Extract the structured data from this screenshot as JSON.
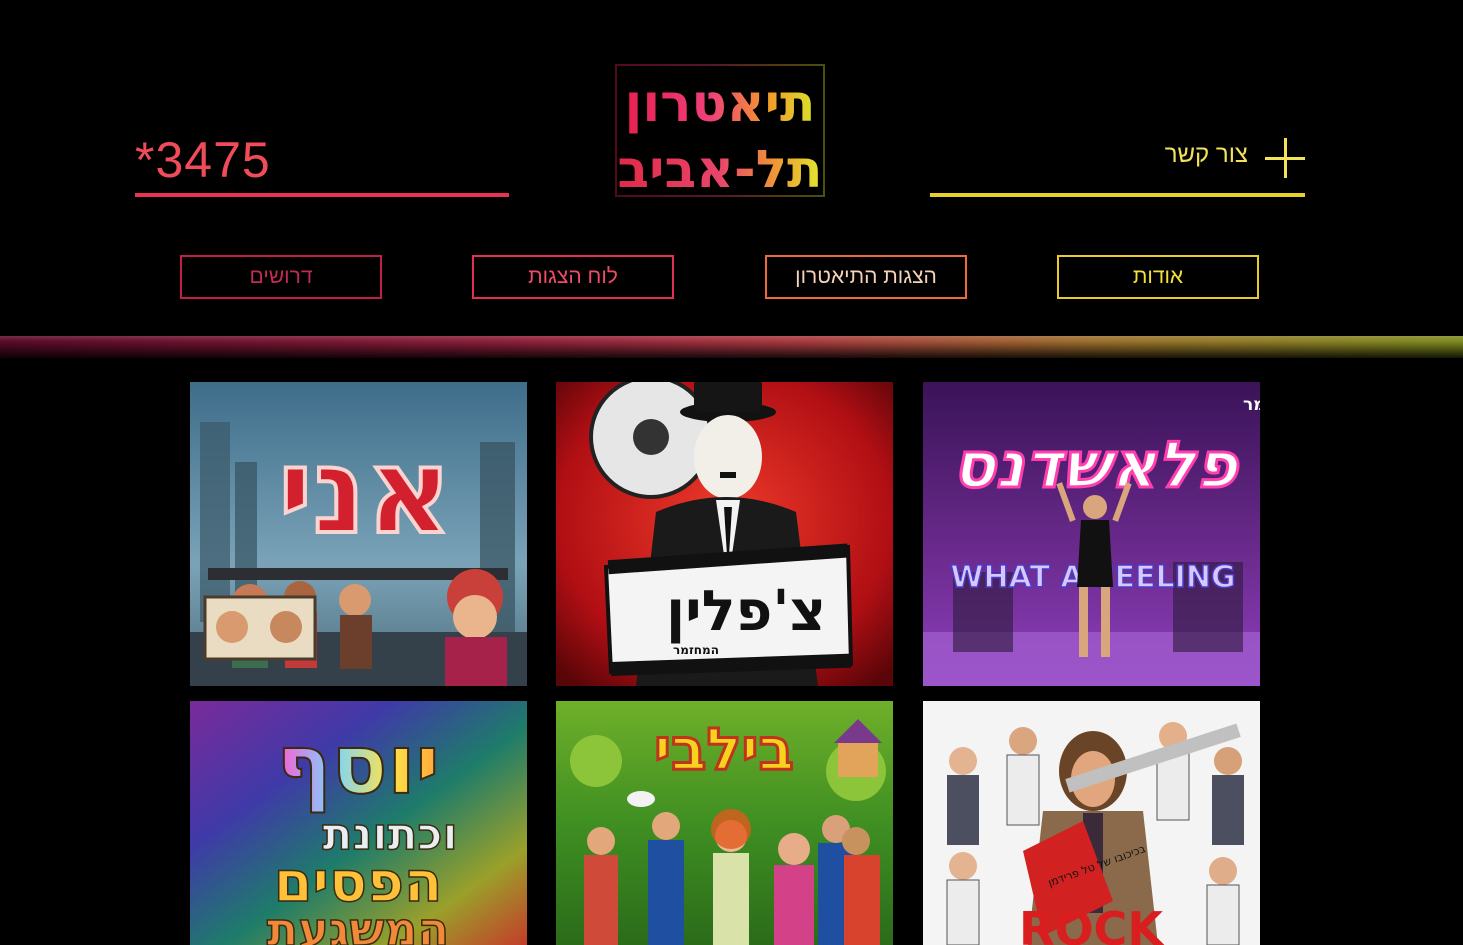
{
  "header": {
    "phone": "*3475",
    "contact_label": "צור קשר",
    "logo_line1": "תיאטרון",
    "logo_line2": "תל-אביב"
  },
  "nav": {
    "items": [
      {
        "label": "אודות"
      },
      {
        "label": "הצגות התיאטרון"
      },
      {
        "label": "לוח הצגות"
      },
      {
        "label": "דרושים"
      }
    ]
  },
  "posters": {
    "annie": {
      "title": "אני"
    },
    "chaplin": {
      "title": "צ'פלין",
      "subtitle": "המחזמר"
    },
    "flashdance": {
      "title": "פלאשדנס",
      "subtitle": "המחזמר",
      "tagline": "WHAT A FEELING"
    },
    "joseph": {
      "title_line1": "יוסף",
      "title_line2": "וכתונת",
      "title_line3": "הפסים",
      "title_line4": "המשגעת"
    },
    "bilbi": {
      "title": "בילבי"
    },
    "rock": {
      "credit": "בכיכובו של טל פרידמן",
      "title": "ROCK"
    }
  },
  "colors": {
    "phone": "#f04b59",
    "contact": "#f2e25a",
    "background": "#000000"
  }
}
